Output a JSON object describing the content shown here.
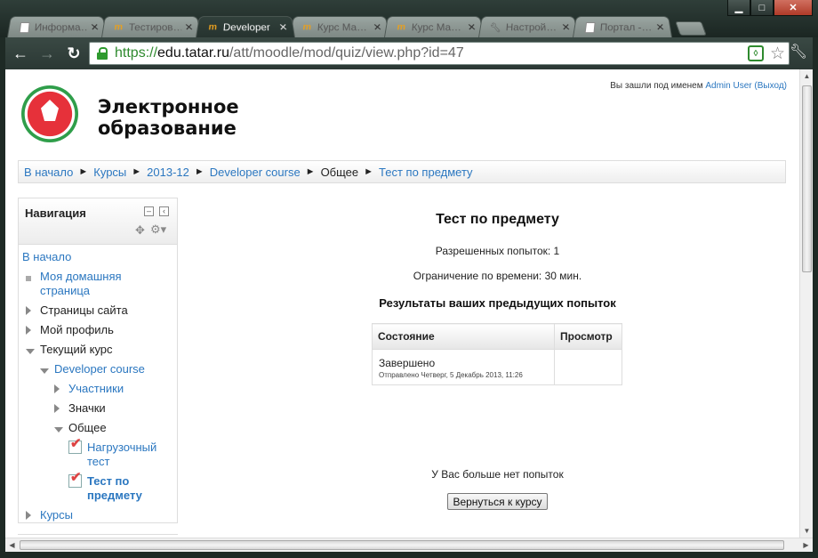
{
  "window": {
    "minimize": "▁",
    "maximize": "□",
    "close": "✕"
  },
  "tabs": [
    {
      "title": "Информа…",
      "icon": "document-icon",
      "active": false
    },
    {
      "title": "Тестиров…",
      "icon": "moodle-icon",
      "active": false
    },
    {
      "title": "Developer",
      "icon": "moodle-icon",
      "active": true
    },
    {
      "title": "Курс Ма…",
      "icon": "moodle-icon",
      "active": false
    },
    {
      "title": "Курс Ма…",
      "icon": "moodle-icon",
      "active": false
    },
    {
      "title": "Настрой…",
      "icon": "wrench-icon",
      "active": false
    },
    {
      "title": "Портал -…",
      "icon": "document-icon",
      "active": false
    }
  ],
  "toolbar": {
    "back": "←",
    "forward": "→",
    "reload": "↻",
    "url_scheme": "https://",
    "url_host": "edu.tatar.ru",
    "url_path": "/att/moodle/mod/quiz/view.php?id=47"
  },
  "header": {
    "site_name_line1": "Электронное",
    "site_name_line2": "образование",
    "logged_in_prefix": "Вы зашли под именем",
    "user_name": "Admin User",
    "logout": "(Выход)"
  },
  "breadcrumb": [
    {
      "label": "В начало",
      "link": true
    },
    {
      "label": "Курсы",
      "link": true
    },
    {
      "label": "2013-12",
      "link": true
    },
    {
      "label": "Developer course",
      "link": true
    },
    {
      "label": "Общее",
      "link": false
    },
    {
      "label": "Тест по предмету",
      "link": true
    }
  ],
  "breadcrumb_sep": "►",
  "navigation": {
    "title": "Навигация",
    "items": [
      {
        "label": "В начало",
        "marker": "none",
        "link": true,
        "indent": 0
      },
      {
        "label": "Моя домашняя страница",
        "marker": "bullet",
        "link": true,
        "indent": 0
      },
      {
        "label": "Страницы сайта",
        "marker": "right",
        "link": false,
        "indent": 0
      },
      {
        "label": "Мой профиль",
        "marker": "right",
        "link": false,
        "indent": 0
      },
      {
        "label": "Текущий курс",
        "marker": "down",
        "link": false,
        "indent": 0
      },
      {
        "label": "Developer course",
        "marker": "down",
        "link": true,
        "indent": 1
      },
      {
        "label": "Участники",
        "marker": "right",
        "link": true,
        "indent": 2
      },
      {
        "label": "Значки",
        "marker": "right",
        "link": false,
        "indent": 2
      },
      {
        "label": "Общее",
        "marker": "down",
        "link": false,
        "indent": 2
      },
      {
        "label": "Нагрузочный тест",
        "marker": "quiz",
        "link": true,
        "indent": 3
      },
      {
        "label": "Тест по предмету",
        "marker": "quiz",
        "link": true,
        "indent": 3,
        "bold": true
      },
      {
        "label": "Курсы",
        "marker": "right",
        "link": true,
        "indent": 0
      }
    ]
  },
  "quiz": {
    "title": "Тест по предмету",
    "attempts_allowed": "Разрешенных попыток: 1",
    "time_limit": "Ограничение по времени: 30 мин.",
    "results_title": "Результаты ваших предыдущих попыток",
    "col_state": "Состояние",
    "col_review": "Просмотр",
    "attempt_state": "Завершено",
    "attempt_submitted": "Отправлено Четверг, 5 Декабрь 2013, 11:26",
    "no_more_attempts": "У Вас больше нет попыток",
    "back_button": "Вернуться к курсу"
  },
  "colors": {
    "link": "#2b77c0",
    "chrome_dark": "#2b3834"
  }
}
